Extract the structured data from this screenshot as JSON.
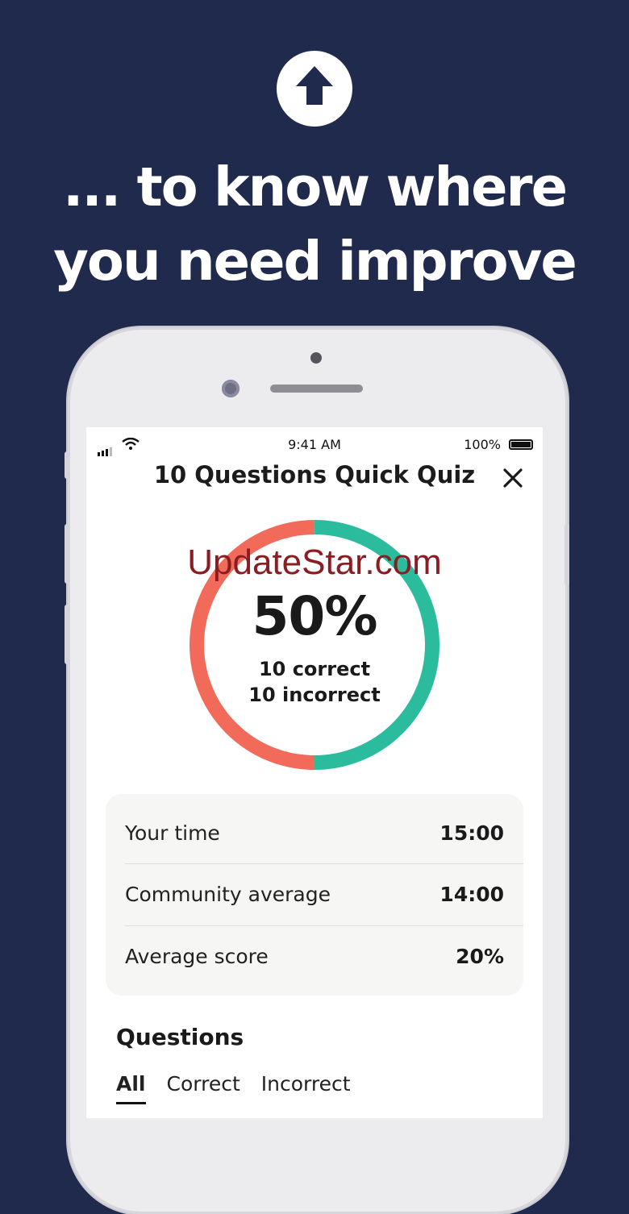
{
  "promo": {
    "badge_icon": "arrow-up-icon",
    "headline_line1": "... to know where",
    "headline_line2": "you need improve"
  },
  "status_bar": {
    "time": "9:41 AM",
    "battery": "100%"
  },
  "quiz": {
    "title": "10 Questions Quick Quiz",
    "close_icon": "close-icon",
    "watermark": "UpdateStar.com"
  },
  "result": {
    "percent_label": "50%",
    "percent_value": 50,
    "correct_text": "10 correct",
    "incorrect_text": "10 incorrect",
    "colors": {
      "correct": "#2bbc9d",
      "incorrect": "#f26a5a"
    }
  },
  "stats": [
    {
      "label": "Your time",
      "value": "15:00"
    },
    {
      "label": "Community average",
      "value": "14:00"
    },
    {
      "label": "Average score",
      "value": "20%"
    }
  ],
  "questions": {
    "heading": "Questions",
    "tabs": [
      {
        "label": "All",
        "active": true
      },
      {
        "label": "Correct",
        "active": false
      },
      {
        "label": "Incorrect",
        "active": false
      }
    ]
  },
  "colors": {
    "background": "#1f2a4d"
  }
}
